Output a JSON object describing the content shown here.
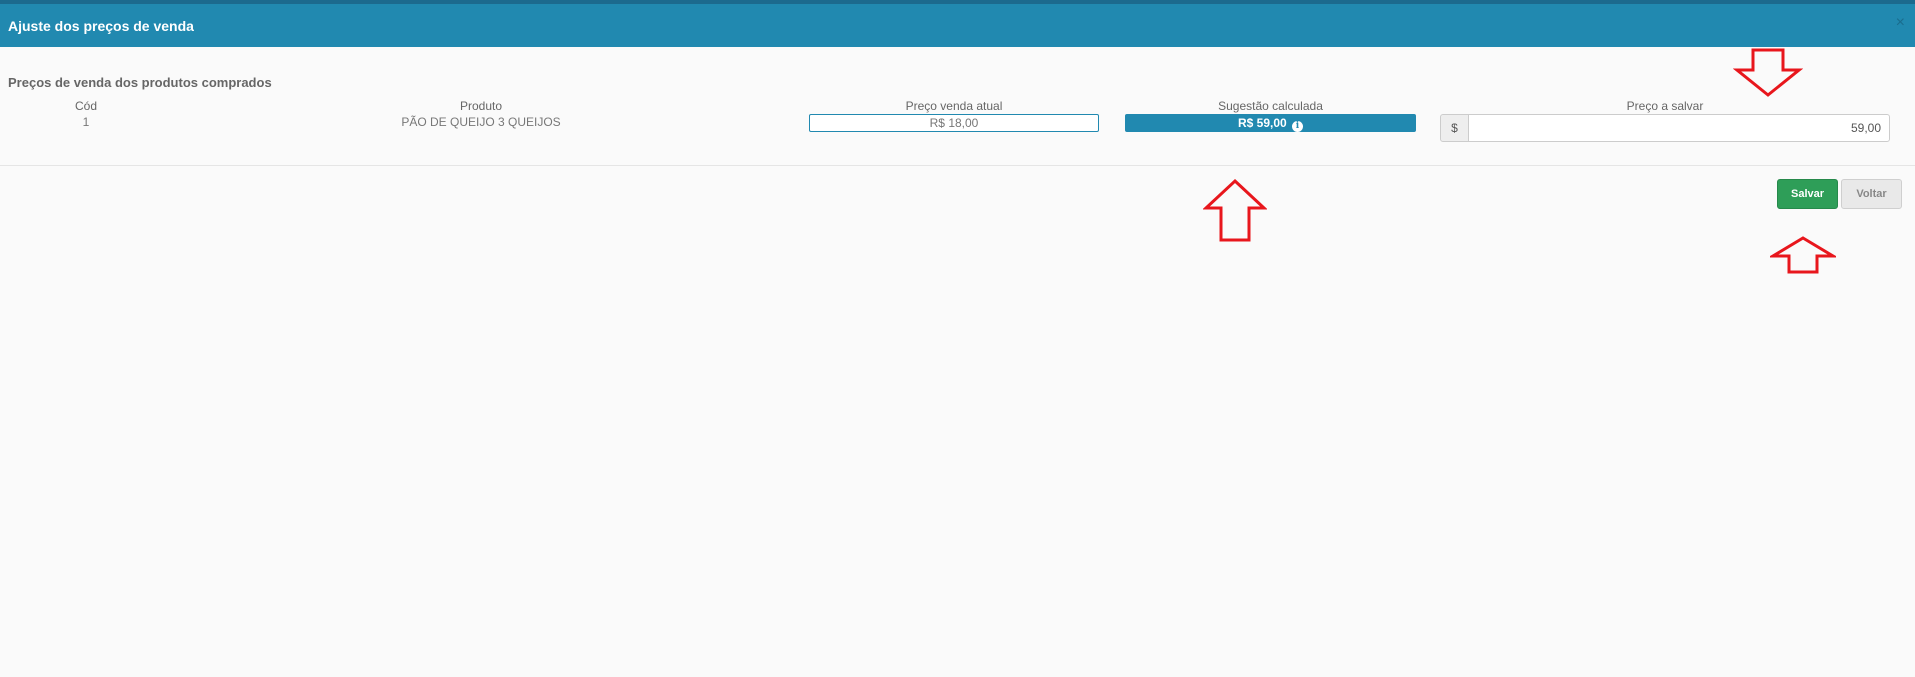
{
  "modal": {
    "title": "Ajuste dos preços de venda",
    "close_glyph": "×"
  },
  "section": {
    "title": "Preços de venda dos produtos comprados"
  },
  "table": {
    "headers": {
      "code": "Cód",
      "product": "Produto",
      "current_price": "Preço venda atual",
      "suggestion": "Sugestão calculada",
      "price_to_save": "Preço a salvar"
    },
    "row": {
      "code": "1",
      "product": "PÃO DE QUEIJO 3 QUEIJOS",
      "current_price": "R$ 18,00",
      "suggestion": "R$ 59,00",
      "currency_addon": "$",
      "price_to_save": "59,00"
    }
  },
  "actions": {
    "save_label": "Salvar",
    "back_label": "Voltar"
  },
  "icons": {
    "info": "info-icon",
    "close": "close-icon",
    "annotation": "arrow-icon"
  },
  "colors": {
    "header_bg": "#2189b0",
    "save_green": "#2e9e58",
    "annotation_red": "#e8161c"
  }
}
